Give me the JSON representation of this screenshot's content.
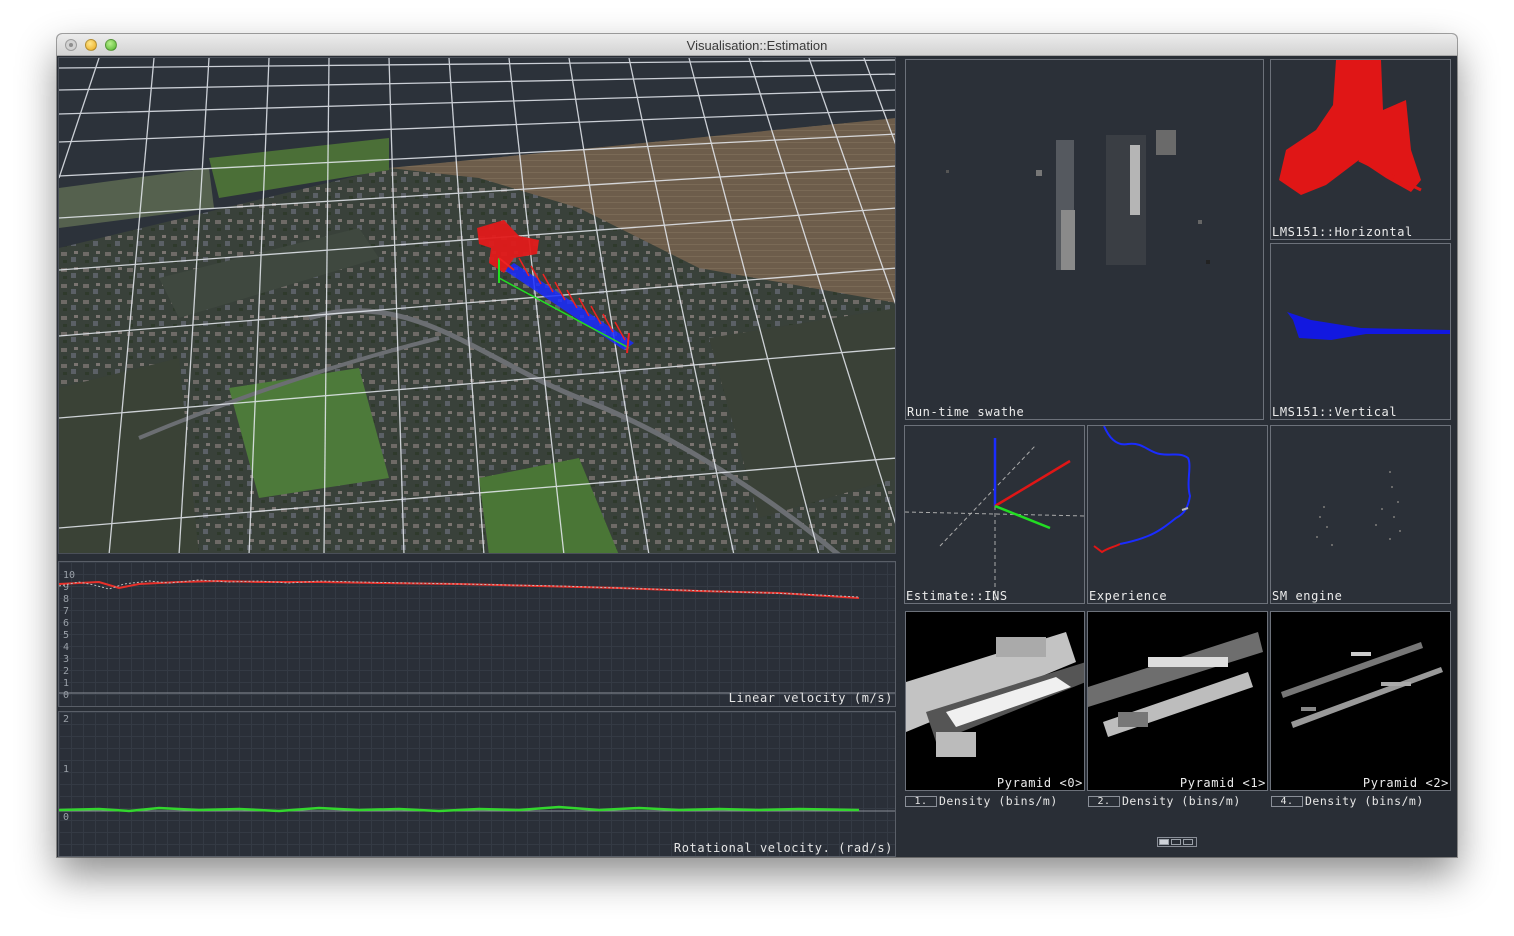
{
  "window": {
    "title": "Visualisation::Estimation"
  },
  "plots": {
    "linear": {
      "label": "Linear velocity (m/s)",
      "ticks": [
        "10",
        "9",
        "8",
        "7",
        "6",
        "5",
        "4",
        "3",
        "2",
        "1",
        "0"
      ]
    },
    "rotational": {
      "label": "Rotational velocity. (rad/s)",
      "ticks": [
        "2",
        "1",
        "0"
      ]
    }
  },
  "panels": {
    "swathe": "Run-time swathe",
    "horizontal": "LMS151::Horizontal",
    "vertical": "LMS151::Vertical",
    "ins": "Estimate::INS",
    "experience": "Experience",
    "sm_engine": "SM engine"
  },
  "pyramids": [
    {
      "label": "Pyramid <0>",
      "index": "1.",
      "density": "Density (bins/m)"
    },
    {
      "label": "Pyramid <1>",
      "index": "2.",
      "density": "Density (bins/m)"
    },
    {
      "label": "Pyramid <2>",
      "index": "4.",
      "density": "Density (bins/m)"
    }
  ],
  "colors": {
    "background": "#292e36",
    "linear_series": "#e8302a",
    "rotational_series": "#33d62e",
    "trajectory": "#1a2cff"
  },
  "icons": [
    "close-icon",
    "minimize-icon",
    "zoom-icon",
    "page-indicator-icon"
  ]
}
